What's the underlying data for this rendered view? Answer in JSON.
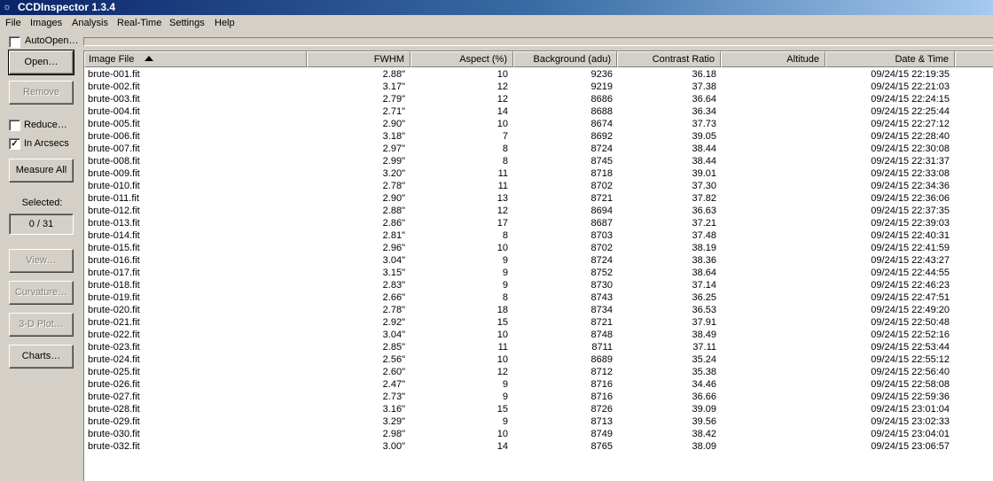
{
  "window": {
    "title": "CCDInspector 1.3.4"
  },
  "menu": [
    "File",
    "Images",
    "Analysis",
    "Real-Time",
    "Settings",
    "Help"
  ],
  "toolbar": {
    "autoopen_label": "AutoOpen…",
    "autoopen_checked": false
  },
  "sidebar": {
    "open": "Open…",
    "remove": "Remove",
    "reduce": "Reduce…",
    "reduce_checked": false,
    "in_arcsecs": "In Arcsecs",
    "in_arcsecs_checked": true,
    "measure_all": "Measure All",
    "selected_label": "Selected:",
    "selected_value": "0 / 31",
    "view": "View…",
    "curvature": "Curvature…",
    "plot3d": "3-D Plot…",
    "charts": "Charts…"
  },
  "table": {
    "columns": [
      "Image File",
      "FWHM",
      "Aspect (%)",
      "Background (adu)",
      "Contrast Ratio",
      "Altitude",
      "Date & Time"
    ],
    "sort_column": "Image File",
    "sort_direction": "ascending",
    "rows": [
      [
        "brute-001.fit",
        "2.88\"",
        "10",
        "9236",
        "36.18",
        "",
        "09/24/15 22:19:35"
      ],
      [
        "brute-002.fit",
        "3.17\"",
        "12",
        "9219",
        "37.38",
        "",
        "09/24/15 22:21:03"
      ],
      [
        "brute-003.fit",
        "2.79\"",
        "12",
        "8686",
        "36.64",
        "",
        "09/24/15 22:24:15"
      ],
      [
        "brute-004.fit",
        "2.71\"",
        "14",
        "8688",
        "36.34",
        "",
        "09/24/15 22:25:44"
      ],
      [
        "brute-005.fit",
        "2.90\"",
        "10",
        "8674",
        "37.73",
        "",
        "09/24/15 22:27:12"
      ],
      [
        "brute-006.fit",
        "3.18\"",
        "7",
        "8692",
        "39.05",
        "",
        "09/24/15 22:28:40"
      ],
      [
        "brute-007.fit",
        "2.97\"",
        "8",
        "8724",
        "38.44",
        "",
        "09/24/15 22:30:08"
      ],
      [
        "brute-008.fit",
        "2.99\"",
        "8",
        "8745",
        "38.44",
        "",
        "09/24/15 22:31:37"
      ],
      [
        "brute-009.fit",
        "3.20\"",
        "11",
        "8718",
        "39.01",
        "",
        "09/24/15 22:33:08"
      ],
      [
        "brute-010.fit",
        "2.78\"",
        "11",
        "8702",
        "37.30",
        "",
        "09/24/15 22:34:36"
      ],
      [
        "brute-011.fit",
        "2.90\"",
        "13",
        "8721",
        "37.82",
        "",
        "09/24/15 22:36:06"
      ],
      [
        "brute-012.fit",
        "2.88\"",
        "12",
        "8694",
        "36.63",
        "",
        "09/24/15 22:37:35"
      ],
      [
        "brute-013.fit",
        "2.86\"",
        "17",
        "8687",
        "37.21",
        "",
        "09/24/15 22:39:03"
      ],
      [
        "brute-014.fit",
        "2.81\"",
        "8",
        "8703",
        "37.48",
        "",
        "09/24/15 22:40:31"
      ],
      [
        "brute-015.fit",
        "2.96\"",
        "10",
        "8702",
        "38.19",
        "",
        "09/24/15 22:41:59"
      ],
      [
        "brute-016.fit",
        "3.04\"",
        "9",
        "8724",
        "38.36",
        "",
        "09/24/15 22:43:27"
      ],
      [
        "brute-017.fit",
        "3.15\"",
        "9",
        "8752",
        "38.64",
        "",
        "09/24/15 22:44:55"
      ],
      [
        "brute-018.fit",
        "2.83\"",
        "9",
        "8730",
        "37.14",
        "",
        "09/24/15 22:46:23"
      ],
      [
        "brute-019.fit",
        "2.66\"",
        "8",
        "8743",
        "36.25",
        "",
        "09/24/15 22:47:51"
      ],
      [
        "brute-020.fit",
        "2.78\"",
        "18",
        "8734",
        "36.53",
        "",
        "09/24/15 22:49:20"
      ],
      [
        "brute-021.fit",
        "2.92\"",
        "15",
        "8721",
        "37.91",
        "",
        "09/24/15 22:50:48"
      ],
      [
        "brute-022.fit",
        "3.04\"",
        "10",
        "8748",
        "38.49",
        "",
        "09/24/15 22:52:16"
      ],
      [
        "brute-023.fit",
        "2.85\"",
        "11",
        "8711",
        "37.11",
        "",
        "09/24/15 22:53:44"
      ],
      [
        "brute-024.fit",
        "2.56\"",
        "10",
        "8689",
        "35.24",
        "",
        "09/24/15 22:55:12"
      ],
      [
        "brute-025.fit",
        "2.60\"",
        "12",
        "8712",
        "35.38",
        "",
        "09/24/15 22:56:40"
      ],
      [
        "brute-026.fit",
        "2.47\"",
        "9",
        "8716",
        "34.46",
        "",
        "09/24/15 22:58:08"
      ],
      [
        "brute-027.fit",
        "2.73\"",
        "9",
        "8716",
        "36.66",
        "",
        "09/24/15 22:59:36"
      ],
      [
        "brute-028.fit",
        "3.16\"",
        "15",
        "8726",
        "39.09",
        "",
        "09/24/15 23:01:04"
      ],
      [
        "brute-029.fit",
        "3.29\"",
        "9",
        "8713",
        "39.56",
        "",
        "09/24/15 23:02:33"
      ],
      [
        "brute-030.fit",
        "2.98\"",
        "10",
        "8749",
        "38.42",
        "",
        "09/24/15 23:04:01"
      ],
      [
        "brute-032.fit",
        "3.00\"",
        "14",
        "8765",
        "38.09",
        "",
        "09/24/15 23:06:57"
      ]
    ]
  }
}
